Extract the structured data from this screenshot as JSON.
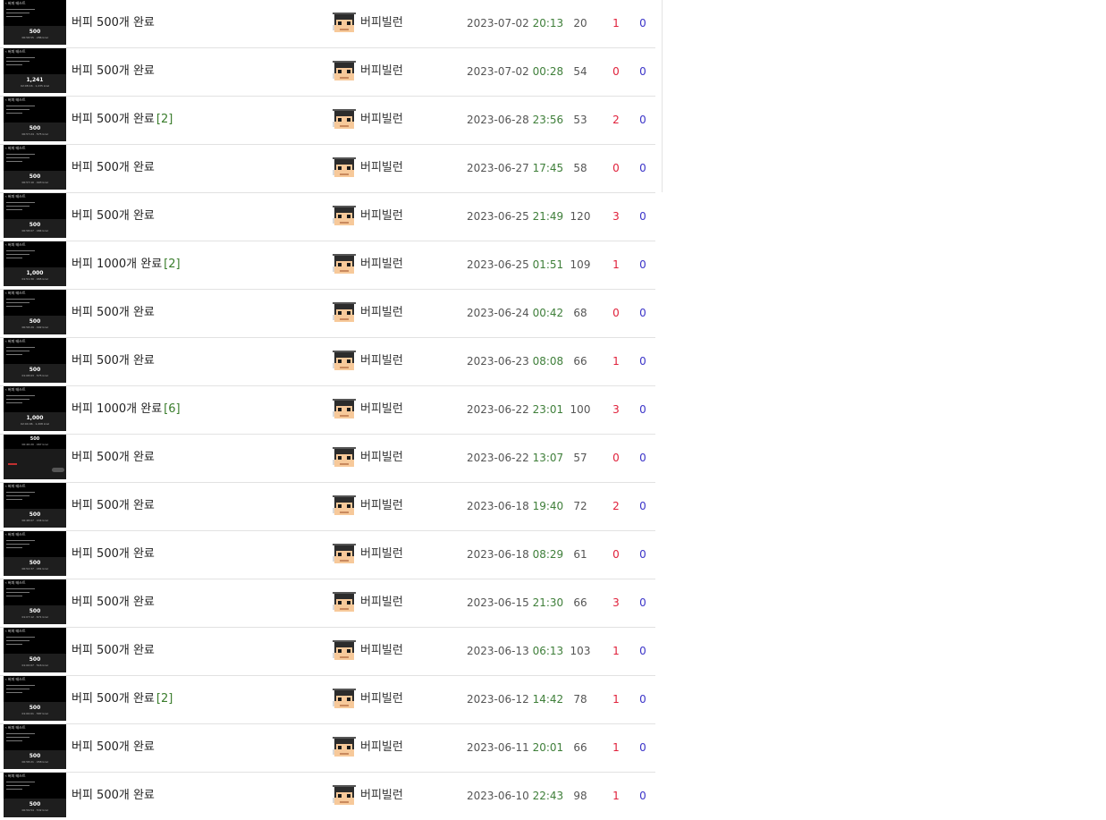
{
  "colors": {
    "comment_count": "#3a7d2c",
    "time": "#3f7f3a",
    "upvote": "#e0203a",
    "downvote": "#3a33c8"
  },
  "rows": [
    {
      "title": "버피 500개 완료",
      "comments": "",
      "author": "버피빌런",
      "date": "2023-07-02",
      "time": "20:13",
      "views": "20",
      "up": "1",
      "down": "0",
      "thumb": {
        "count": "500",
        "sub": "00:58:55 · 286 kcal",
        "variant": "normal"
      }
    },
    {
      "title": "버피 500개 완료",
      "comments": "",
      "author": "버피빌런",
      "date": "2023-07-02",
      "time": "00:28",
      "views": "54",
      "up": "0",
      "down": "0",
      "thumb": {
        "count": "1,241",
        "sub": "02:08:16 · 1,235 kcal",
        "variant": "normal"
      }
    },
    {
      "title": "버피 500개 완료",
      "comments": "[2]",
      "author": "버피빌런",
      "date": "2023-06-28",
      "time": "23:56",
      "views": "53",
      "up": "2",
      "down": "0",
      "thumb": {
        "count": "500",
        "sub": "00:57:24 · 575 kcal",
        "variant": "normal"
      }
    },
    {
      "title": "버피 500개 완료",
      "comments": "",
      "author": "버피빌런",
      "date": "2023-06-27",
      "time": "17:45",
      "views": "58",
      "up": "0",
      "down": "0",
      "thumb": {
        "count": "500",
        "sub": "00:57:10 · 493 kcal",
        "variant": "normal"
      }
    },
    {
      "title": "버피 500개 완료",
      "comments": "",
      "author": "버피빌런",
      "date": "2023-06-25",
      "time": "21:49",
      "views": "120",
      "up": "3",
      "down": "0",
      "thumb": {
        "count": "500",
        "sub": "00:58:07 · 484 kcal",
        "variant": "normal"
      }
    },
    {
      "title": "버피 1000개 완료",
      "comments": "[2]",
      "author": "버피빌런",
      "date": "2023-06-25",
      "time": "01:51",
      "views": "109",
      "up": "1",
      "down": "0",
      "thumb": {
        "count": "1,000",
        "sub": "01:51:30 · 965 kcal",
        "variant": "normal"
      }
    },
    {
      "title": "버피 500개 완료",
      "comments": "",
      "author": "버피빌런",
      "date": "2023-06-24",
      "time": "00:42",
      "views": "68",
      "up": "0",
      "down": "0",
      "thumb": {
        "count": "500",
        "sub": "00:58:29 · 492 kcal",
        "variant": "normal"
      }
    },
    {
      "title": "버피 500개 완료",
      "comments": "",
      "author": "버피빌런",
      "date": "2023-06-23",
      "time": "08:08",
      "views": "66",
      "up": "1",
      "down": "0",
      "thumb": {
        "count": "500",
        "sub": "01:08:03 · 575 kcal",
        "variant": "normal"
      }
    },
    {
      "title": "버피 1000개 완료",
      "comments": "[6]",
      "author": "버피빌런",
      "date": "2023-06-22",
      "time": "23:01",
      "views": "100",
      "up": "3",
      "down": "0",
      "thumb": {
        "count": "1,000",
        "sub": "02:04:06 · 1,208 kcal",
        "variant": "normal"
      }
    },
    {
      "title": "버피 500개 완료",
      "comments": "",
      "author": "버피빌런",
      "date": "2023-06-22",
      "time": "13:07",
      "views": "57",
      "up": "0",
      "down": "0",
      "thumb": {
        "count": "500",
        "sub": "00:46:20 · 467 kcal",
        "variant": "alt"
      }
    },
    {
      "title": "버피 500개 완료",
      "comments": "",
      "author": "버피빌런",
      "date": "2023-06-18",
      "time": "19:40",
      "views": "72",
      "up": "2",
      "down": "0",
      "thumb": {
        "count": "500",
        "sub": "00:48:07 · 434 kcal",
        "variant": "normal"
      }
    },
    {
      "title": "버피 500개 완료",
      "comments": "",
      "author": "버피빌런",
      "date": "2023-06-18",
      "time": "08:29",
      "views": "61",
      "up": "0",
      "down": "0",
      "thumb": {
        "count": "500",
        "sub": "00:52:37 · 481 kcal",
        "variant": "normal"
      }
    },
    {
      "title": "버피 500개 완료",
      "comments": "",
      "author": "버피빌런",
      "date": "2023-06-15",
      "time": "21:30",
      "views": "66",
      "up": "3",
      "down": "0",
      "thumb": {
        "count": "500",
        "sub": "01:07:12 · 671 kcal",
        "variant": "normal"
      }
    },
    {
      "title": "버피 500개 완료",
      "comments": "",
      "author": "버피빌런",
      "date": "2023-06-13",
      "time": "06:13",
      "views": "103",
      "up": "1",
      "down": "0",
      "thumb": {
        "count": "500",
        "sub": "01:00:07 · 516 kcal",
        "variant": "normal"
      }
    },
    {
      "title": "버피 500개 완료",
      "comments": "[2]",
      "author": "버피빌런",
      "date": "2023-06-12",
      "time": "14:42",
      "views": "78",
      "up": "1",
      "down": "0",
      "thumb": {
        "count": "500",
        "sub": "01:00:01 · 587 kcal",
        "variant": "normal"
      }
    },
    {
      "title": "버피 500개 완료",
      "comments": "",
      "author": "버피빌런",
      "date": "2023-06-11",
      "time": "20:01",
      "views": "66",
      "up": "1",
      "down": "0",
      "thumb": {
        "count": "500",
        "sub": "00:58:21 · 458 kcal",
        "variant": "normal"
      }
    },
    {
      "title": "버피 500개 완료",
      "comments": "",
      "author": "버피빌런",
      "date": "2023-06-10",
      "time": "22:43",
      "views": "98",
      "up": "1",
      "down": "0",
      "thumb": {
        "count": "500",
        "sub": "00:59:54 · 532 kcal",
        "variant": "normal"
      }
    }
  ]
}
